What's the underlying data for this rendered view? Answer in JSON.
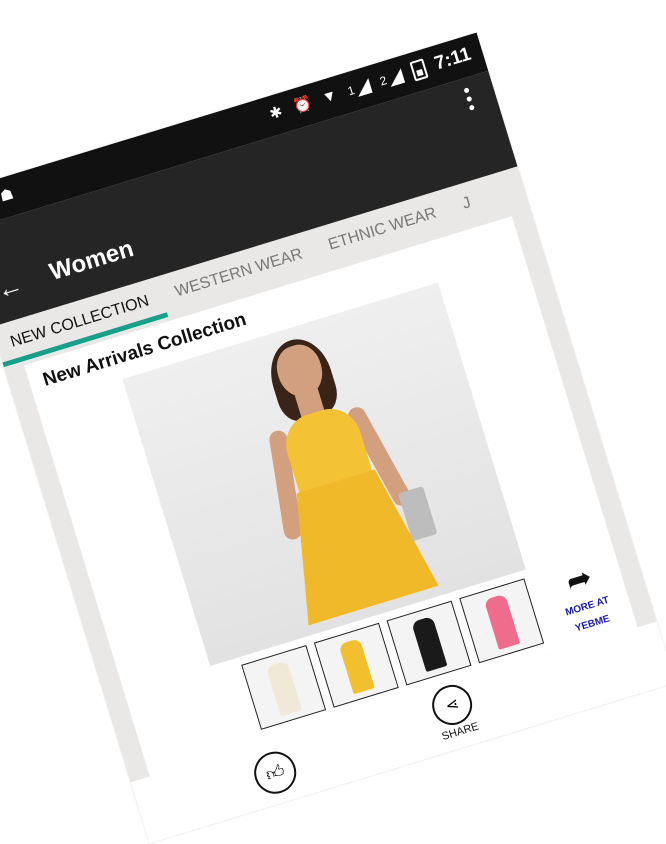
{
  "statusbar": {
    "time": "7:11",
    "sim1": "1",
    "sim2": "2",
    "icons": [
      "whatsapp-icon",
      "android-icon",
      "bluetooth-icon",
      "alarm-icon",
      "wifi-icon",
      "signal-icon",
      "battery-icon"
    ]
  },
  "appbar": {
    "title": "Women",
    "back_icon": "arrow-left-icon",
    "menu_icon": "more-vert-icon"
  },
  "tabs": [
    {
      "label": "NEW COLLECTION",
      "active": true
    },
    {
      "label": "WESTERN WEAR",
      "active": false
    },
    {
      "label": "ETHNIC WEAR",
      "active": false
    },
    {
      "label": "J",
      "active": false
    }
  ],
  "main": {
    "section_title": "New Arrivals Collection",
    "hero": {
      "label": ""
    },
    "thumbnails": [
      {
        "name": "cream-dress",
        "color": "#f1e9d8"
      },
      {
        "name": "yellow-dress",
        "color": "#f2bf2e"
      },
      {
        "name": "black-dress",
        "color": "#1a1a1a"
      },
      {
        "name": "pink-dress",
        "color": "#f06c8c"
      }
    ],
    "more_label": "MORE AT YEBME"
  },
  "actions": {
    "like_icon": "thumbs-up-icon",
    "share_label": "SHARE",
    "share_icon": "share-icon"
  },
  "navbar": {
    "back_icon": "triangle-back-icon",
    "home_icon": "circle-home-icon",
    "recents_icon": "square-recents-icon"
  },
  "colors": {
    "accent": "#16a08a",
    "appbar": "#252525",
    "statusbar": "#111111",
    "link": "#1a1aa6"
  }
}
